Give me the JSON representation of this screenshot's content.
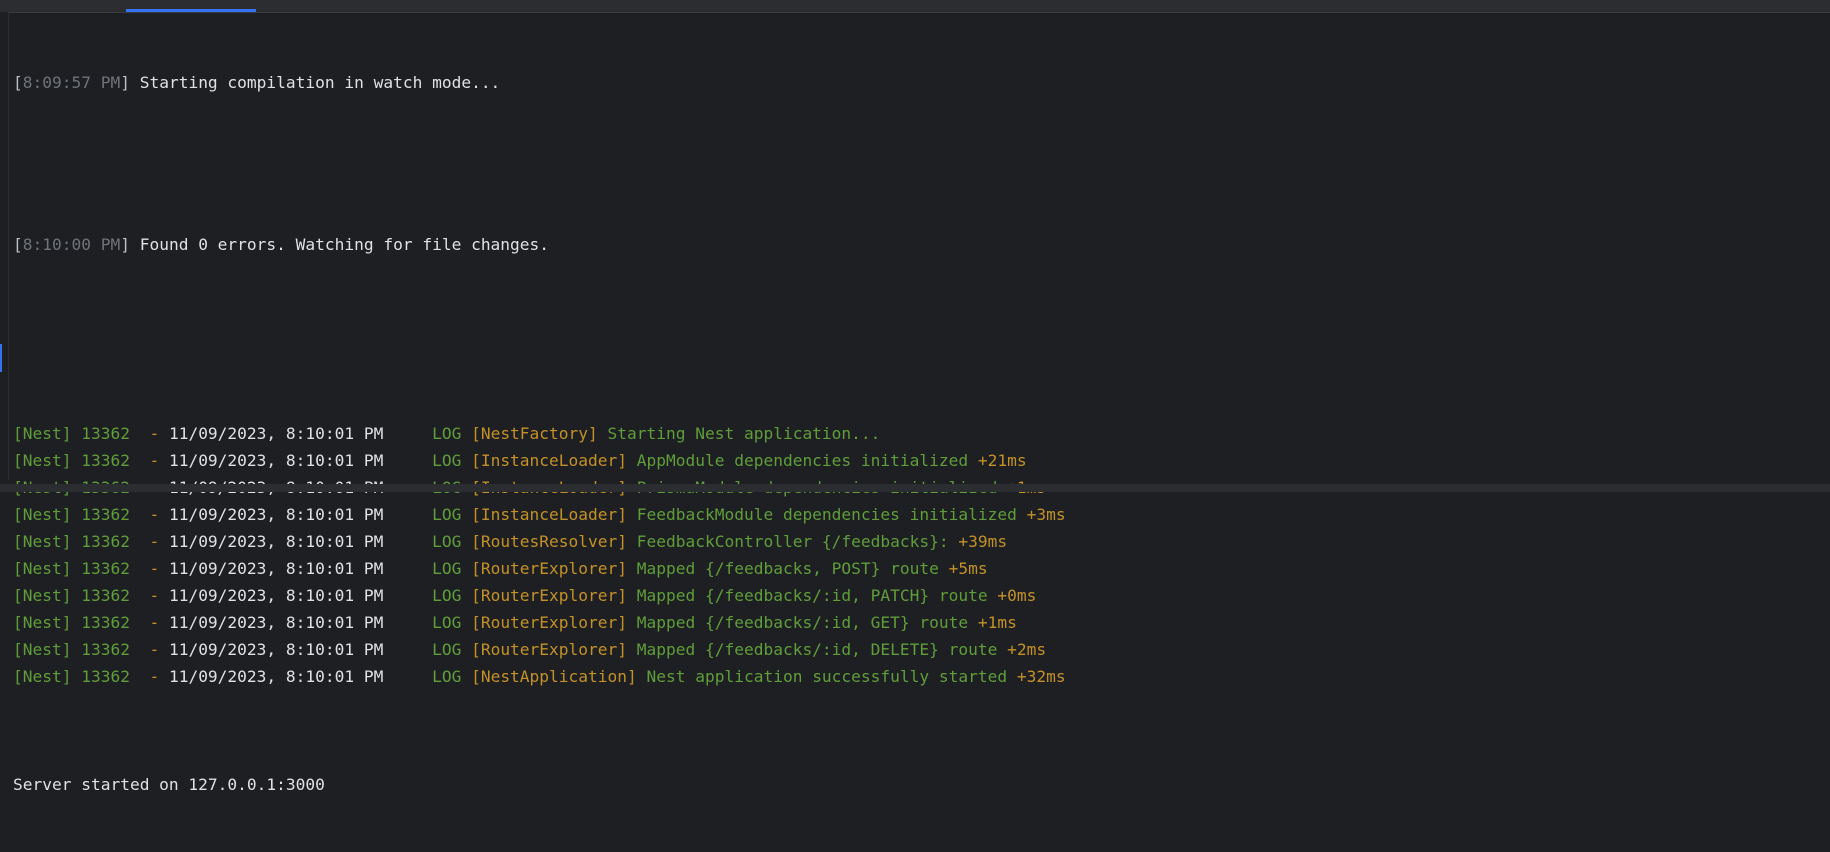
{
  "colors": {
    "background": "#1e1f22",
    "accent": "#3574f0",
    "nest_green": "#5f9e3a",
    "nest_yellow": "#c39128",
    "text": "#bcbec4",
    "timestamp_dim": "#6f737a"
  },
  "watch": [
    {
      "time": "8:09:57 PM",
      "message": " Starting compilation in watch mode..."
    },
    {
      "time": "8:10:00 PM",
      "message": " Found 0 errors. Watching for file changes."
    }
  ],
  "nest_logs": [
    {
      "prefix": "[Nest] 13362  ",
      "dash": "- ",
      "datetime": "11/09/2023, 8:10:01 PM",
      "level": "     LOG ",
      "context": "[NestFactory]",
      "message": " Starting Nest application...",
      "timing": ""
    },
    {
      "prefix": "[Nest] 13362  ",
      "dash": "- ",
      "datetime": "11/09/2023, 8:10:01 PM",
      "level": "     LOG ",
      "context": "[InstanceLoader]",
      "message": " AppModule dependencies initialized ",
      "timing": "+21ms"
    },
    {
      "prefix": "[Nest] 13362  ",
      "dash": "- ",
      "datetime": "11/09/2023, 8:10:01 PM",
      "level": "     LOG ",
      "context": "[InstanceLoader]",
      "message": " PrismaModule dependencies initialized ",
      "timing": "+1ms"
    },
    {
      "prefix": "[Nest] 13362  ",
      "dash": "- ",
      "datetime": "11/09/2023, 8:10:01 PM",
      "level": "     LOG ",
      "context": "[InstanceLoader]",
      "message": " FeedbackModule dependencies initialized ",
      "timing": "+3ms"
    },
    {
      "prefix": "[Nest] 13362  ",
      "dash": "- ",
      "datetime": "11/09/2023, 8:10:01 PM",
      "level": "     LOG ",
      "context": "[RoutesResolver]",
      "message": " FeedbackController {/feedbacks}: ",
      "timing": "+39ms"
    },
    {
      "prefix": "[Nest] 13362  ",
      "dash": "- ",
      "datetime": "11/09/2023, 8:10:01 PM",
      "level": "     LOG ",
      "context": "[RouterExplorer]",
      "message": " Mapped {/feedbacks, POST} route ",
      "timing": "+5ms"
    },
    {
      "prefix": "[Nest] 13362  ",
      "dash": "- ",
      "datetime": "11/09/2023, 8:10:01 PM",
      "level": "     LOG ",
      "context": "[RouterExplorer]",
      "message": " Mapped {/feedbacks/:id, PATCH} route ",
      "timing": "+0ms"
    },
    {
      "prefix": "[Nest] 13362  ",
      "dash": "- ",
      "datetime": "11/09/2023, 8:10:01 PM",
      "level": "     LOG ",
      "context": "[RouterExplorer]",
      "message": " Mapped {/feedbacks/:id, GET} route ",
      "timing": "+1ms"
    },
    {
      "prefix": "[Nest] 13362  ",
      "dash": "- ",
      "datetime": "11/09/2023, 8:10:01 PM",
      "level": "     LOG ",
      "context": "[RouterExplorer]",
      "message": " Mapped {/feedbacks/:id, DELETE} route ",
      "timing": "+2ms"
    },
    {
      "prefix": "[Nest] 13362  ",
      "dash": "- ",
      "datetime": "11/09/2023, 8:10:01 PM",
      "level": "     LOG ",
      "context": "[NestApplication]",
      "message": " Nest application successfully started ",
      "timing": "+32ms"
    }
  ],
  "server_message": "Server started on 127.0.0.1:3000"
}
